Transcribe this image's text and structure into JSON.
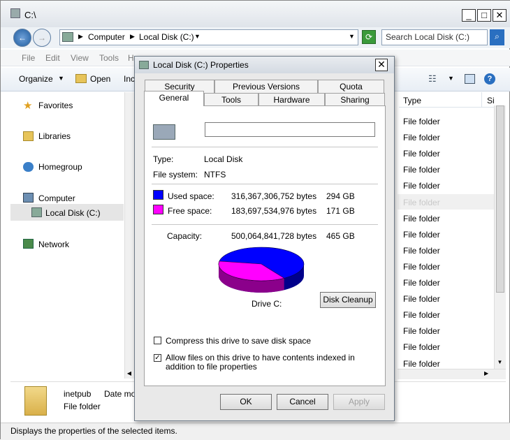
{
  "window": {
    "title": "C:\\"
  },
  "address": {
    "crumbs": [
      "Computer",
      "Local Disk (C:)"
    ],
    "search_placeholder": "Search Local Disk (C:)"
  },
  "menu": [
    "File",
    "Edit",
    "View",
    "Tools",
    "H"
  ],
  "toolbar": {
    "organize": "Organize",
    "open": "Open",
    "include": "Inc"
  },
  "nav": {
    "favorites": "Favorites",
    "libraries": "Libraries",
    "homegroup": "Homegroup",
    "computer": "Computer",
    "local_disk": "Local Disk (C:)",
    "network": "Network"
  },
  "columns": {
    "type": "Type",
    "size": "Si"
  },
  "file_rows": [
    "File folder",
    "File folder",
    "File folder",
    "File folder",
    "File folder",
    "File folder",
    "File folder",
    "File folder",
    "File folder",
    "File folder",
    "File folder",
    "File folder",
    "File folder",
    "File folder",
    "File folder",
    "File folder"
  ],
  "details": {
    "name": "inetpub",
    "date_label": "Date mo",
    "type": "File folder"
  },
  "status": "Displays the properties of the selected items.",
  "dialog": {
    "title": "Local Disk (C:) Properties",
    "tabs_row1": [
      "Security",
      "Previous Versions",
      "Quota"
    ],
    "tabs_row2": [
      "General",
      "Tools",
      "Hardware",
      "Sharing"
    ],
    "name_value": "",
    "type_label": "Type:",
    "type_value": "Local Disk",
    "fs_label": "File system:",
    "fs_value": "NTFS",
    "used_label": "Used space:",
    "used_bytes": "316,367,306,752 bytes",
    "used_gb": "294 GB",
    "free_label": "Free space:",
    "free_bytes": "183,697,534,976 bytes",
    "free_gb": "171 GB",
    "capacity_label": "Capacity:",
    "capacity_bytes": "500,064,841,728 bytes",
    "capacity_gb": "465 GB",
    "drive_label": "Drive C:",
    "disk_cleanup": "Disk Cleanup",
    "compress_label": "Compress this drive to save disk space",
    "index_label": "Allow files on this drive to have contents indexed in addition to file properties",
    "compress_checked": false,
    "index_checked": true,
    "ok": "OK",
    "cancel": "Cancel",
    "apply": "Apply",
    "used_color": "#0000ff",
    "free_color": "#ff00ff",
    "used_fraction": 0.6327
  }
}
